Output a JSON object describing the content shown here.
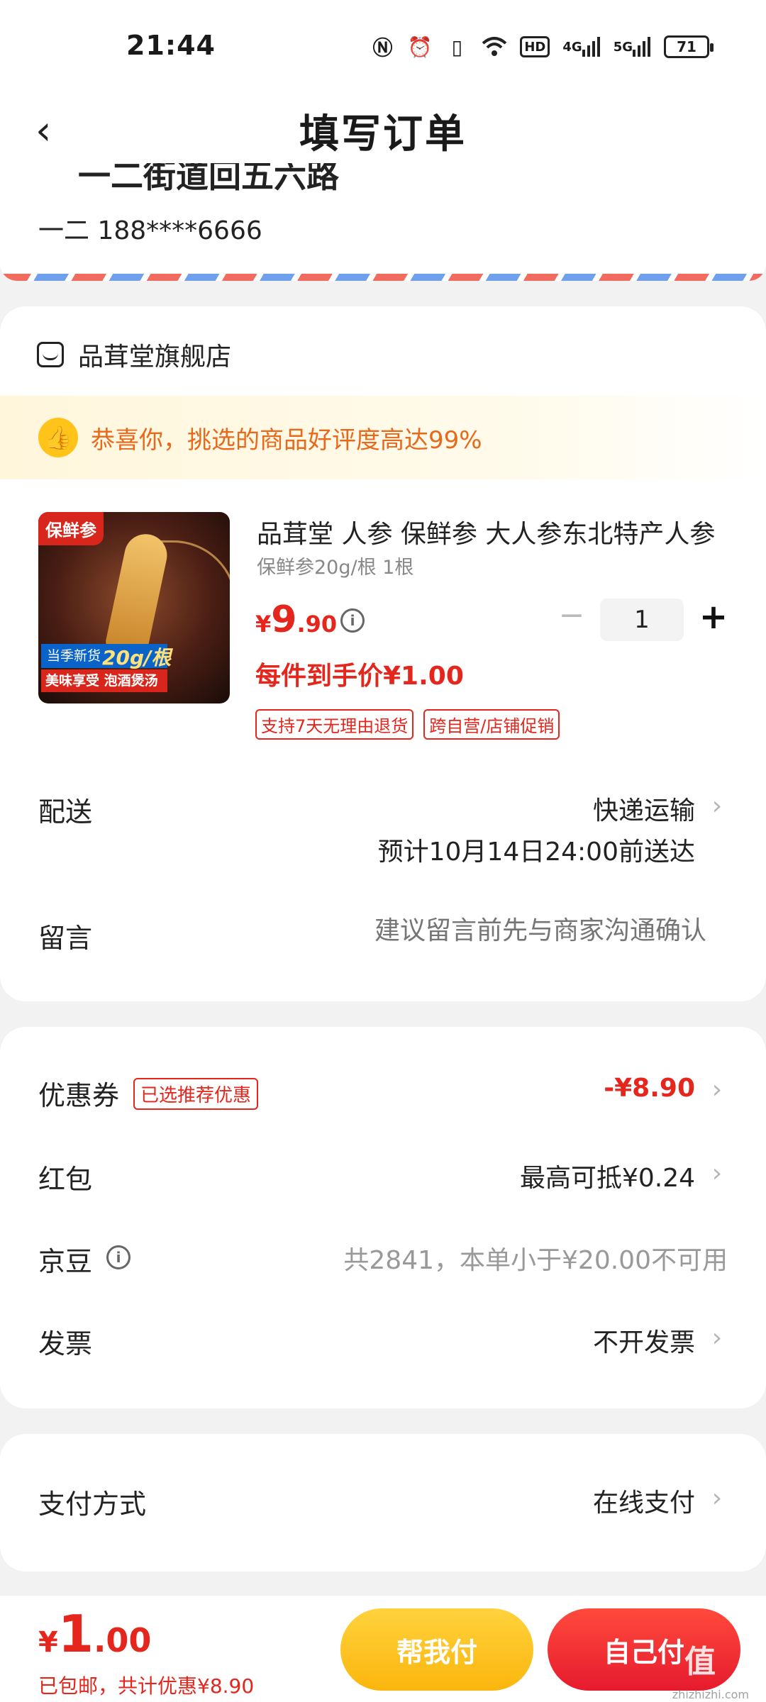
{
  "status_bar": {
    "time": "21:44",
    "icons": [
      "nfc-icon",
      "alarm-icon",
      "vibrate-icon",
      "wifi-icon",
      "hd-icon",
      "signal-4g-icon",
      "signal-5g-icon"
    ],
    "hd_label": "HD",
    "net_4g": "4G",
    "net_5g": "5G",
    "battery": "71"
  },
  "nav": {
    "title": "填写订单"
  },
  "address": {
    "partial_line": "一二街道回五六路",
    "contact": "一二  188****6666"
  },
  "shop": {
    "name": "品茸堂旗舰店",
    "praise": "恭喜你，挑选的商品好评度高达99%",
    "product": {
      "image_tag": "保鲜参",
      "image_badge_left": "当季新货",
      "image_badge_weight": "20g/根",
      "image_badge_bottom": "美味享受 泡酒煲汤",
      "title": "品茸堂 人参 保鲜参 大人参东北特产人参",
      "spec": "保鲜参20g/根 1根",
      "price_currency": "¥",
      "price_int": "9",
      "price_dec": ".90",
      "final_price": "每件到手价¥1.00",
      "quantity": "1",
      "tags": [
        "支持7天无理由退货",
        "跨自营/店铺促销"
      ]
    },
    "delivery": {
      "label": "配送",
      "method": "快递运输",
      "eta": "预计10月14日24:00前送达"
    },
    "message": {
      "label": "留言",
      "placeholder": "建议留言前先与商家沟通确认"
    }
  },
  "benefits": {
    "coupon": {
      "label": "优惠券",
      "tag": "已选推荐优惠",
      "value": "-¥8.90"
    },
    "hongbao": {
      "label": "红包",
      "value": "最高可抵¥0.24"
    },
    "jingdou": {
      "label": "京豆",
      "value": "共2841，本单小于¥20.00不可用"
    },
    "invoice": {
      "label": "发票",
      "value": "不开发票"
    }
  },
  "payment": {
    "label": "支付方式",
    "value": "在线支付"
  },
  "bottom": {
    "currency": "¥",
    "total_int": "1",
    "total_dec": ".00",
    "note": "已包邮，共计优惠¥8.90",
    "help_pay": "帮我付",
    "self_pay": "自己付",
    "watermark": "值",
    "watermark_site": "zhizhizhi.com"
  },
  "colors": {
    "accent_red": "#e4261c",
    "accent_orange": "#e8691c",
    "button_yellow": "#fbb60d",
    "background": "#f2f2f2"
  }
}
